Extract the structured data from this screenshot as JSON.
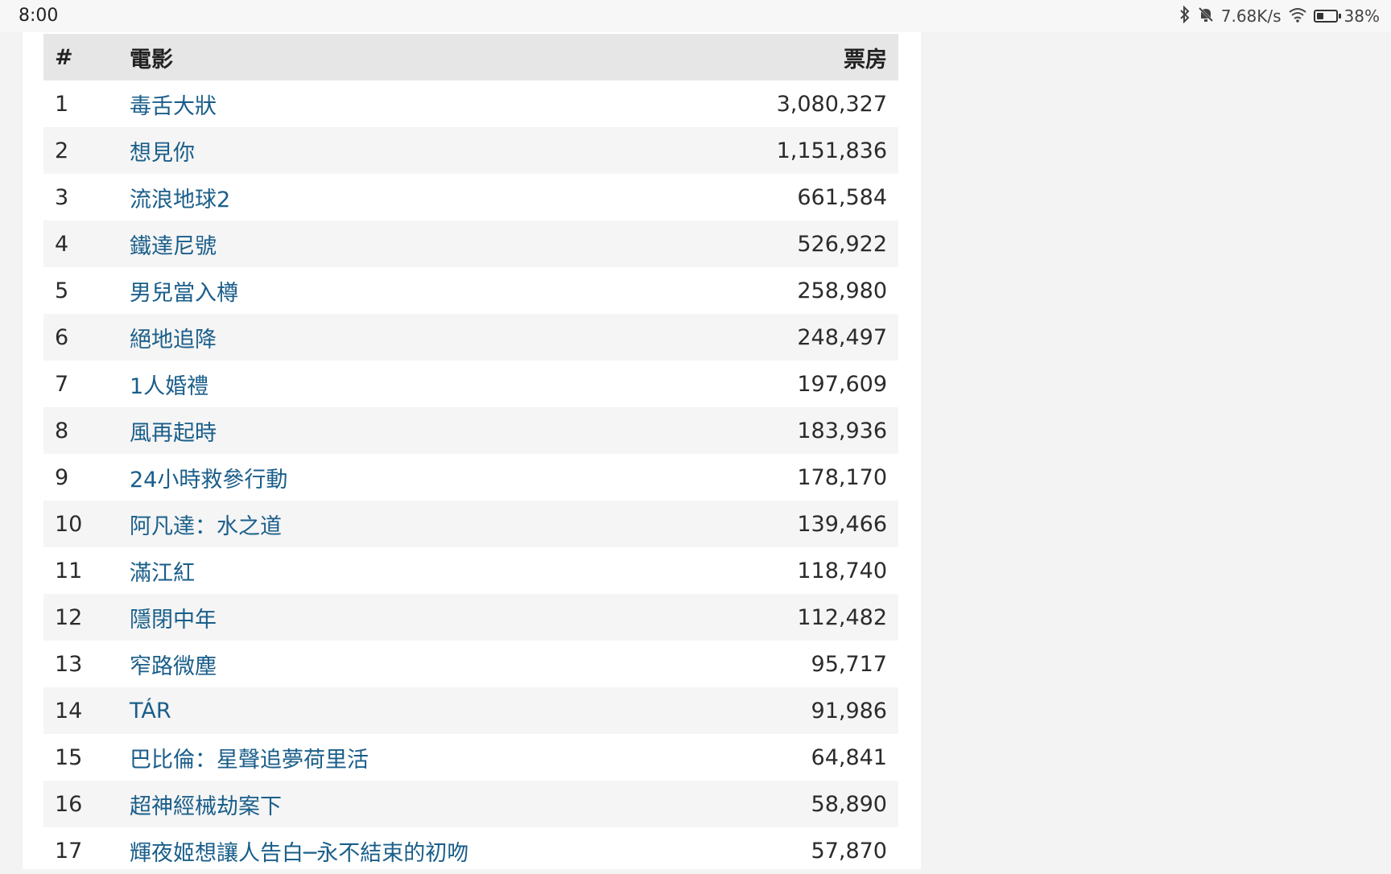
{
  "status_bar": {
    "time": "8:00",
    "net_speed": "7.68K/s",
    "battery_level": 0.38,
    "battery_pct": "38%",
    "icons": [
      "bluetooth-icon",
      "mute-icon",
      "wifi-icon",
      "battery-icon"
    ]
  },
  "table": {
    "headers": {
      "rank": "#",
      "movie": "電影",
      "gross": "票房"
    },
    "rows": [
      {
        "rank": "1",
        "movie": "毒舌大狀",
        "gross": "3,080,327"
      },
      {
        "rank": "2",
        "movie": "想見你",
        "gross": "1,151,836"
      },
      {
        "rank": "3",
        "movie": "流浪地球2",
        "gross": "661,584"
      },
      {
        "rank": "4",
        "movie": "鐵達尼號",
        "gross": "526,922"
      },
      {
        "rank": "5",
        "movie": "男兒當入樽",
        "gross": "258,980"
      },
      {
        "rank": "6",
        "movie": "絕地追降",
        "gross": "248,497"
      },
      {
        "rank": "7",
        "movie": "1人婚禮",
        "gross": "197,609"
      },
      {
        "rank": "8",
        "movie": "風再起時",
        "gross": "183,936"
      },
      {
        "rank": "9",
        "movie": "24小時救參行動",
        "gross": "178,170"
      },
      {
        "rank": "10",
        "movie": "阿凡達：水之道",
        "gross": "139,466"
      },
      {
        "rank": "11",
        "movie": "滿江紅",
        "gross": "118,740"
      },
      {
        "rank": "12",
        "movie": "隱閉中年",
        "gross": "112,482"
      },
      {
        "rank": "13",
        "movie": "窄路微塵",
        "gross": "95,717"
      },
      {
        "rank": "14",
        "movie": "TÁR",
        "gross": "91,986"
      },
      {
        "rank": "15",
        "movie": "巴比倫：星聲追夢荷里活",
        "gross": "64,841"
      },
      {
        "rank": "16",
        "movie": "超神經械劫案下",
        "gross": "58,890"
      },
      {
        "rank": "17",
        "movie": "輝夜姬想讓人告白─永不結束的初吻",
        "gross": "57,870"
      }
    ]
  },
  "colors": {
    "link": "#1a5e8a",
    "header_bg": "#e6e6e6",
    "alt_row_bg": "#f5f5f5",
    "page_bg": "#f3f3f3"
  }
}
